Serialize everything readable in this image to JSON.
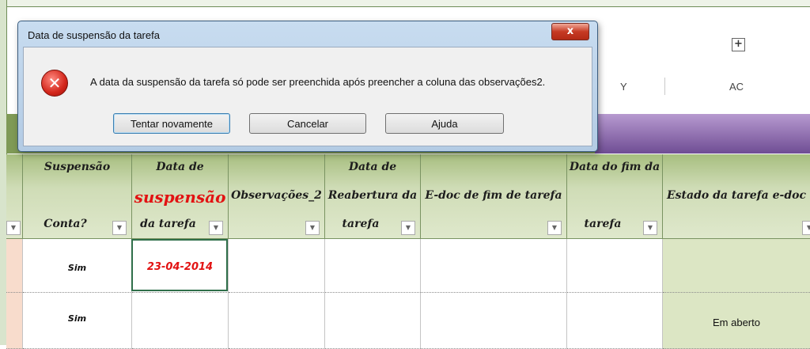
{
  "columns": {
    "y": "Y",
    "ac": "AC",
    "expand_symbol": "+"
  },
  "table": {
    "headers": {
      "suspensao": [
        "Suspensão",
        "Conta?"
      ],
      "data_suspensao": [
        "Data de",
        "suspensão",
        "da tarefa"
      ],
      "observacoes": "Observações_2",
      "data_reabertura": [
        "Data de",
        "Reabertura da",
        "tarefa"
      ],
      "edoc_fim": "E-doc de fim de tarefa",
      "data_fim": [
        "Data do fim da",
        "tarefa"
      ],
      "estado": "Estado da tarefa e-doc"
    },
    "rows": [
      {
        "suspensao": "Sim",
        "data_suspensao": "23-04-2014",
        "estado": ""
      },
      {
        "suspensao": "Sim",
        "data_suspensao": "",
        "estado": "Em aberto"
      }
    ]
  },
  "dialog": {
    "title": "Data de suspensão da tarefa",
    "close": "x",
    "message": "A data da suspensão da tarefa só pode ser preenchida após preencher a coluna das observações2.",
    "buttons": {
      "retry": "Tentar novamente",
      "cancel": "Cancelar",
      "help": "Ajuda"
    }
  },
  "icons": {
    "error": "error-x-icon",
    "filter": "filter-dropdown-icon"
  }
}
